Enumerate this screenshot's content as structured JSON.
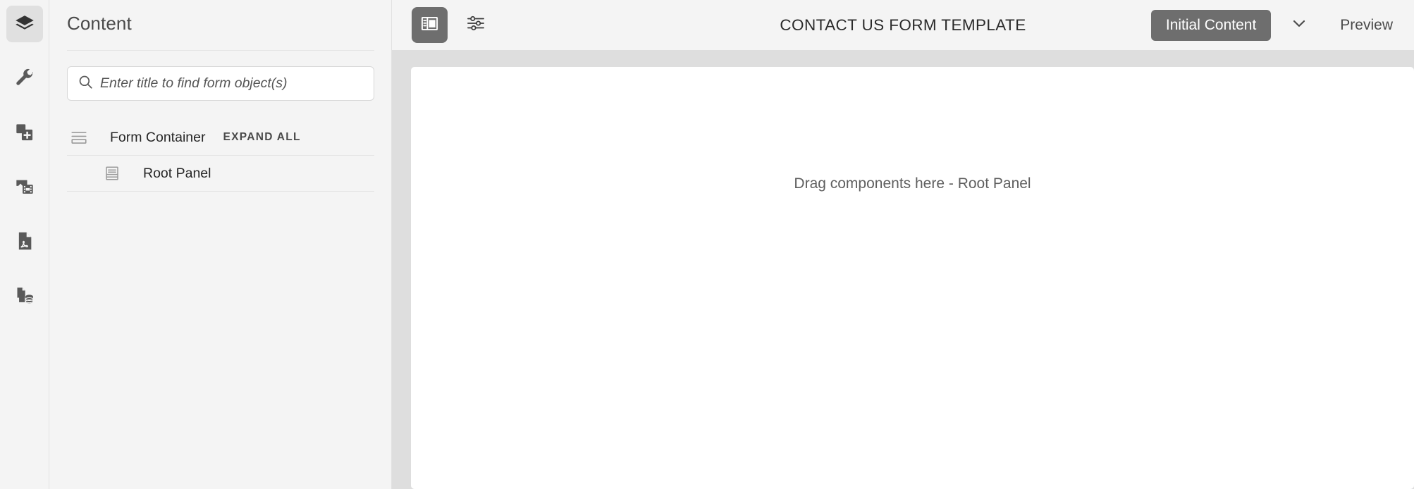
{
  "rail": {
    "items": [
      {
        "name": "layers-icon",
        "label": "Layers",
        "active": true
      },
      {
        "name": "wrench-icon",
        "label": "Tools",
        "active": false
      },
      {
        "name": "add-fragment-icon",
        "label": "Add Fragment",
        "active": false
      },
      {
        "name": "media-icon",
        "label": "Assets",
        "active": false
      },
      {
        "name": "pdf-file-icon",
        "label": "PDF",
        "active": false
      },
      {
        "name": "data-source-icon",
        "label": "Data Source",
        "active": false
      }
    ]
  },
  "content_panel": {
    "title": "Content",
    "search": {
      "placeholder": "Enter title to find form object(s)",
      "value": ""
    },
    "tree": {
      "form_container_label": "Form Container",
      "expand_all_label": "EXPAND ALL",
      "root_panel_label": "Root Panel"
    }
  },
  "topbar": {
    "title": "CONTACT US FORM TEMPLATE",
    "layout_toggle_label": "Toggle side panel",
    "properties_label": "Properties",
    "mode_selector": {
      "selected": "Initial Content",
      "options": [
        "Initial Content"
      ]
    },
    "preview_label": "Preview"
  },
  "canvas": {
    "drop_hint": "Drag components here - Root Panel"
  },
  "colors": {
    "accent": "#6e6e6e",
    "panel_bg": "#f4f4f4",
    "canvas_bg": "#dedede",
    "text": "#2b2b2b"
  }
}
